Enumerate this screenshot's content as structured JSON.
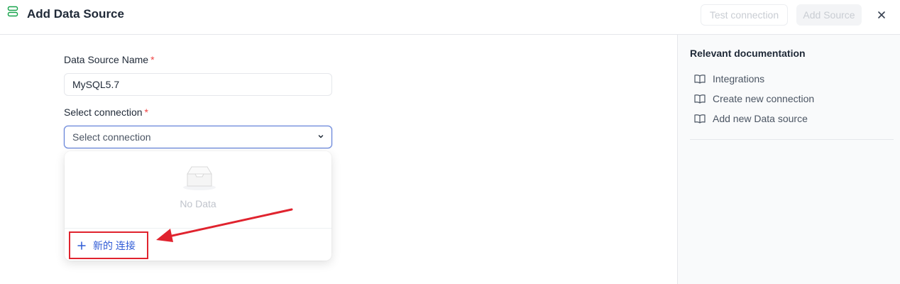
{
  "header": {
    "title": "Add Data Source",
    "test_button": "Test connection",
    "add_button": "Add Source"
  },
  "form": {
    "name_label": "Data Source Name",
    "name_required": "*",
    "name_value": "MySQL5.7",
    "connection_label": "Select connection",
    "connection_required": "*",
    "connection_placeholder": "Select connection"
  },
  "dropdown": {
    "empty_text": "No Data",
    "new_connection_label": "新的 连接"
  },
  "docs": {
    "title": "Relevant documentation",
    "links": [
      {
        "label": "Integrations"
      },
      {
        "label": "Create new connection"
      },
      {
        "label": "Add new Data source"
      }
    ]
  },
  "colors": {
    "accent_blue": "#2f5bd6",
    "annotation_red": "#e0232e",
    "brand_green": "#16a34a",
    "required_red": "#ef4444"
  },
  "icons": [
    "datasource-icon",
    "close-icon",
    "chevron-down-icon",
    "empty-inbox-icon",
    "plus-icon",
    "book-icon"
  ]
}
